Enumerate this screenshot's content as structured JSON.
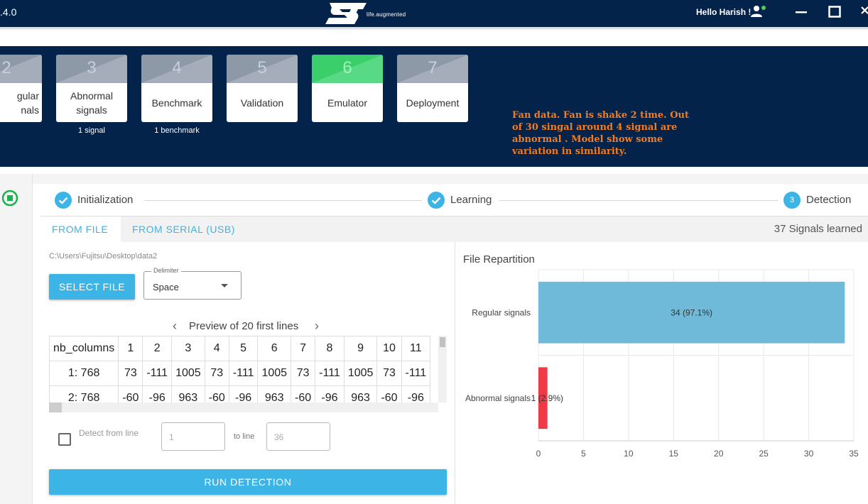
{
  "app": {
    "version": ".4.0",
    "logo_tagline": "life.augmented",
    "greeting": "Hello Harish !",
    "window_controls": [
      "minimize-icon",
      "maximize-icon",
      "close-icon"
    ]
  },
  "steps": [
    {
      "number": "2",
      "label": "gular\nnals",
      "sub": "signal",
      "active": false
    },
    {
      "number": "3",
      "label": "Abnormal signals",
      "sub": "1 signal",
      "active": false
    },
    {
      "number": "4",
      "label": "Benchmark",
      "sub": "1 benchmark",
      "active": false
    },
    {
      "number": "5",
      "label": "Validation",
      "sub": "",
      "active": false
    },
    {
      "number": "6",
      "label": "Emulator",
      "sub": "",
      "active": true
    },
    {
      "number": "7",
      "label": "Deployment",
      "sub": "",
      "active": false
    }
  ],
  "note": "Fan data. Fan is shake 2 time. Out of 30 singal around 4 signal are abnormal . Model show some variation in similarity.",
  "stepper": {
    "items": [
      {
        "label": "Initialization",
        "state": "done"
      },
      {
        "label": "Learning",
        "state": "done"
      },
      {
        "label": "Detection",
        "state": "current",
        "number": "3"
      }
    ]
  },
  "tabs": {
    "items": [
      "FROM FILE",
      "FROM SERIAL (USB)"
    ],
    "active": 0,
    "signals_learned": "37 Signals learned"
  },
  "file": {
    "path": "C:\\Users\\Fujitsu\\Desktop\\data2",
    "select_label": "SELECT FILE",
    "delimiter_label": "Delimiter",
    "delimiter_value": "Space"
  },
  "preview": {
    "title": "Preview of 20 first lines",
    "headers": [
      "nb_columns",
      "1",
      "2",
      "3",
      "4",
      "5",
      "6",
      "7",
      "8",
      "9",
      "10",
      "11"
    ],
    "rows": [
      [
        "1: 768",
        "73",
        "-111",
        "1005",
        "73",
        "-111",
        "1005",
        "73",
        "-111",
        "1005",
        "73",
        "-111"
      ],
      [
        "2: 768",
        "-60",
        "-96",
        "963",
        "-60",
        "-96",
        "963",
        "-60",
        "-96",
        "963",
        "-60",
        "-96"
      ]
    ]
  },
  "detect_range": {
    "label": "Detect from line",
    "from_placeholder": "1",
    "to_label": "to line",
    "to_placeholder": "36"
  },
  "run_label": "RUN DETECTION",
  "colors": {
    "navy": "#03234b",
    "accent_blue": "#3cb4e5",
    "active_green": "#3bcf6b",
    "note_orange": "#f47c20",
    "bar_regular": "#6fbad9",
    "bar_abnormal": "#ef3b48"
  },
  "chart_data": {
    "type": "bar",
    "orientation": "horizontal",
    "title": "File Repartition",
    "categories": [
      "Regular signals",
      "Abnormal signals"
    ],
    "values": [
      34,
      1
    ],
    "data_labels": [
      "34 (97.1%)",
      "1 (2.9%)"
    ],
    "xlim": [
      0,
      35
    ],
    "xticks": [
      0,
      5,
      10,
      15,
      20,
      25,
      30,
      35
    ],
    "grid": true,
    "colors": [
      "#6fbad9",
      "#ef3b48"
    ]
  }
}
